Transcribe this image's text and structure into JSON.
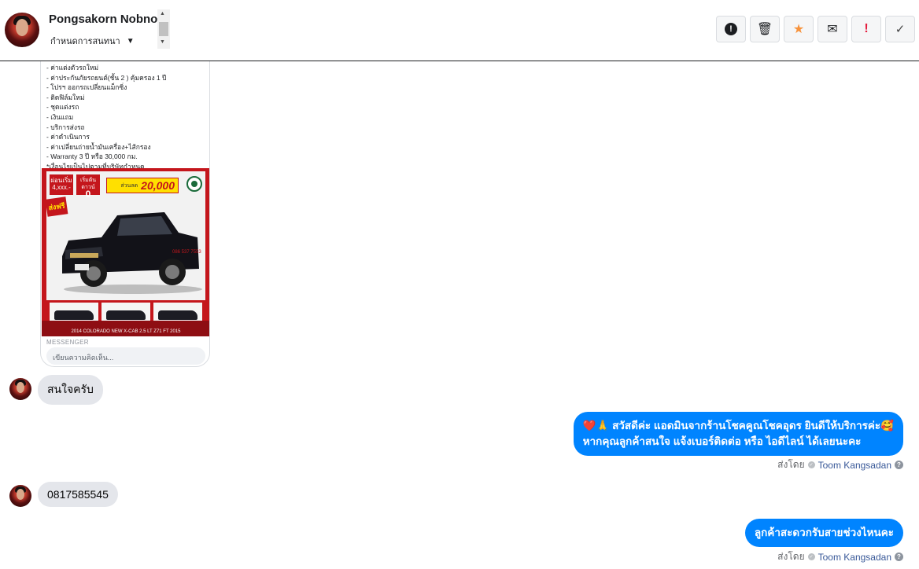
{
  "header": {
    "contact_name": "Pongsakorn Nobnom",
    "assign_label": "กำหนดการสนทนา",
    "toolbar": [
      {
        "name": "report-button",
        "icon": "alert-icon",
        "glyph": "!"
      },
      {
        "name": "delete-button",
        "icon": "trash-icon",
        "glyph": "🗑"
      },
      {
        "name": "star-button",
        "icon": "star-icon",
        "glyph": "★"
      },
      {
        "name": "mark-unread-button",
        "icon": "envelope-icon",
        "glyph": "✉"
      },
      {
        "name": "important-button",
        "icon": "exclamation-icon",
        "glyph": "!"
      },
      {
        "name": "done-button",
        "icon": "check-icon",
        "glyph": "✓"
      }
    ]
  },
  "post": {
    "lines": [
      "- ค่าแต่งตัวรถใหม่",
      "- ค่าประกันภัยรถยนต์(ชั้น 2 ) คุ้มครอง 1 ปี",
      "- โปรฯ ออกรถเปลี่ยนแม็กซิ่ง",
      "- ติดฟิล์มใหม่",
      "- ชุดแต่งรถ",
      "- เงินแถม",
      "- บริการส่งรถ",
      "- ค่าดำเนินการ",
      "- ค่าเปลี่ยนถ่ายน้ำมันเครื่อง+ไส้กรอง",
      "- Warranty 3 ปี หรือ 30,000 กม.",
      "*เงื่อนไขเป็นไปตามที่บริษัทกำหนด"
    ],
    "promo": {
      "monthly_label": "ผ่อนเริ่ม",
      "monthly_value": "4,xxx.-",
      "down_label": "เริ่มต้นดาวน์",
      "down_value": "0",
      "discount_label": "ส่วนลด",
      "discount_value": "20,000",
      "free_label": "ส่งฟรี",
      "phone": "086 537 7553",
      "model_caption": "2014 COLORADO NEW X-CAB 2.5 LT Z71 FT 2015"
    },
    "messenger_label": "MESSENGER",
    "comment_placeholder": "เขียนความคิดเห็น..."
  },
  "messages": [
    {
      "direction": "in",
      "text": "สนใจครับ"
    },
    {
      "direction": "out",
      "lines": [
        "❤️🙏 สวัสดีค่ะ แอดมินจากร้านโชคคูณโชคอุดร ยินดีให้บริการค่ะ🥰",
        "หากคุณลูกค้าสนใจ แจ้งเบอร์ติดต่อ หรือ ไอดีไลน์ ได้เลยนะคะ"
      ],
      "sent_by_label": "ส่งโดย",
      "sender": "Toom Kangsadan"
    },
    {
      "direction": "in",
      "text": "0817585545"
    },
    {
      "direction": "out",
      "lines": [
        "ลูกค้าสะดวกรับสายช่วงไหนคะ"
      ],
      "sent_by_label": "ส่งโดย",
      "sender": "Toom Kangsadan"
    }
  ],
  "colors": {
    "outgoing_bubble": "#0084ff",
    "incoming_bubble": "#e4e6eb",
    "star": "#f7923b",
    "important": "#e41e3f",
    "promo_red": "#c4161c"
  }
}
